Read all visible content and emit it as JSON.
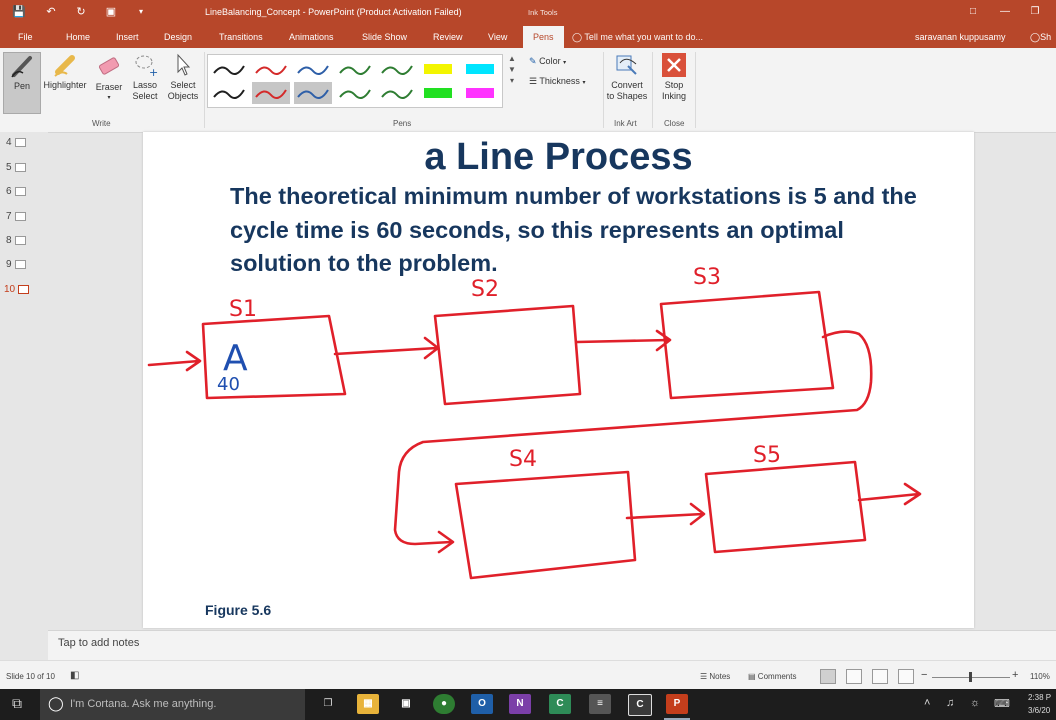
{
  "titlebar": {
    "doc_title": "LineBalancing_Concept - PowerPoint (Product Activation Failed)",
    "context_label": "Ink Tools"
  },
  "tabs": [
    {
      "label": "File"
    },
    {
      "label": "Home"
    },
    {
      "label": "Insert"
    },
    {
      "label": "Design"
    },
    {
      "label": "Transitions"
    },
    {
      "label": "Animations"
    },
    {
      "label": "Slide Show"
    },
    {
      "label": "Review"
    },
    {
      "label": "View"
    },
    {
      "label": "Pens"
    }
  ],
  "tell_me": "Tell me what you want to do...",
  "user_name": "saravanan kuppusamy",
  "share_label": "Sh",
  "ribbon": {
    "pen": "Pen",
    "highlighter": "Highlighter",
    "eraser": "Eraser",
    "lasso_1": "Lasso",
    "lasso_2": "Select",
    "select_1": "Select",
    "select_2": "Objects",
    "write_group": "Write",
    "pens_group": "Pens",
    "color": "Color",
    "thickness": "Thickness",
    "convert_1": "Convert",
    "convert_2": "to Shapes",
    "inkart_group": "Ink Art",
    "stop_1": "Stop",
    "stop_2": "Inking",
    "close_group": "Close"
  },
  "pen_colors": [
    "#1f1f1f",
    "#d42a2a",
    "#2e5fa8",
    "#2e7d32",
    "#2e7d32",
    "#f3f500",
    "#00e5ff",
    "#1f1f1f",
    "#d42a2a",
    "#2e5fa8",
    "#2e7d32",
    "#2e7d32",
    "#22e022",
    "#ff33ff"
  ],
  "thumbnails": [
    "4",
    "5",
    "6",
    "7",
    "8",
    "9",
    "10"
  ],
  "slide": {
    "title": "a Line Process",
    "body": "The theoretical minimum number of workstations is 5 and the cycle time is 60 seconds, so this represents an optimal solution to the problem.",
    "figure_label": "Figure 5.6",
    "ink_labels": [
      "S1",
      "S2",
      "S3",
      "S4",
      "S5",
      "A",
      "40"
    ]
  },
  "notes_placeholder": "Tap to add notes",
  "status": {
    "slide_info": "Slide 10 of 10",
    "notes": "Notes",
    "comments": "Comments",
    "zoom": "110%"
  },
  "taskbar": {
    "search_placeholder": "I'm Cortana. Ask me anything.",
    "time": "2:38 P",
    "date": "3/6/20"
  }
}
